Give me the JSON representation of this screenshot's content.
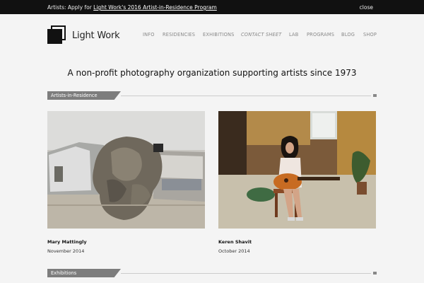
{
  "announcement": {
    "prefix": "Artists: Apply for ",
    "link": "Light Work's 2016 Artist-in-Residence Program",
    "close_label": "close"
  },
  "brand": {
    "name": "Light Work",
    "logo_icon": "light-work-logo-icon"
  },
  "nav": {
    "items": [
      "INFO",
      "RESIDENCIES",
      "EXHIBITIONS",
      "CONTACT SHEET",
      "LAB",
      "PROGRAMS",
      "BLOG",
      "SHOP"
    ]
  },
  "tagline": "A non-profit photography organization supporting artists since 1973",
  "sections": {
    "residence_label": "Artists-in-Residence",
    "exhibitions_label": "Exhibitions"
  },
  "artists": [
    {
      "name": "Mary Mattingly",
      "date": "November 2014"
    },
    {
      "name": "Keren Shavit",
      "date": "October 2014"
    }
  ],
  "colors": {
    "topbar": "#111111",
    "section_tab": "#7d7d7d",
    "nav_text": "#888888",
    "background": "#f4f4f4"
  }
}
